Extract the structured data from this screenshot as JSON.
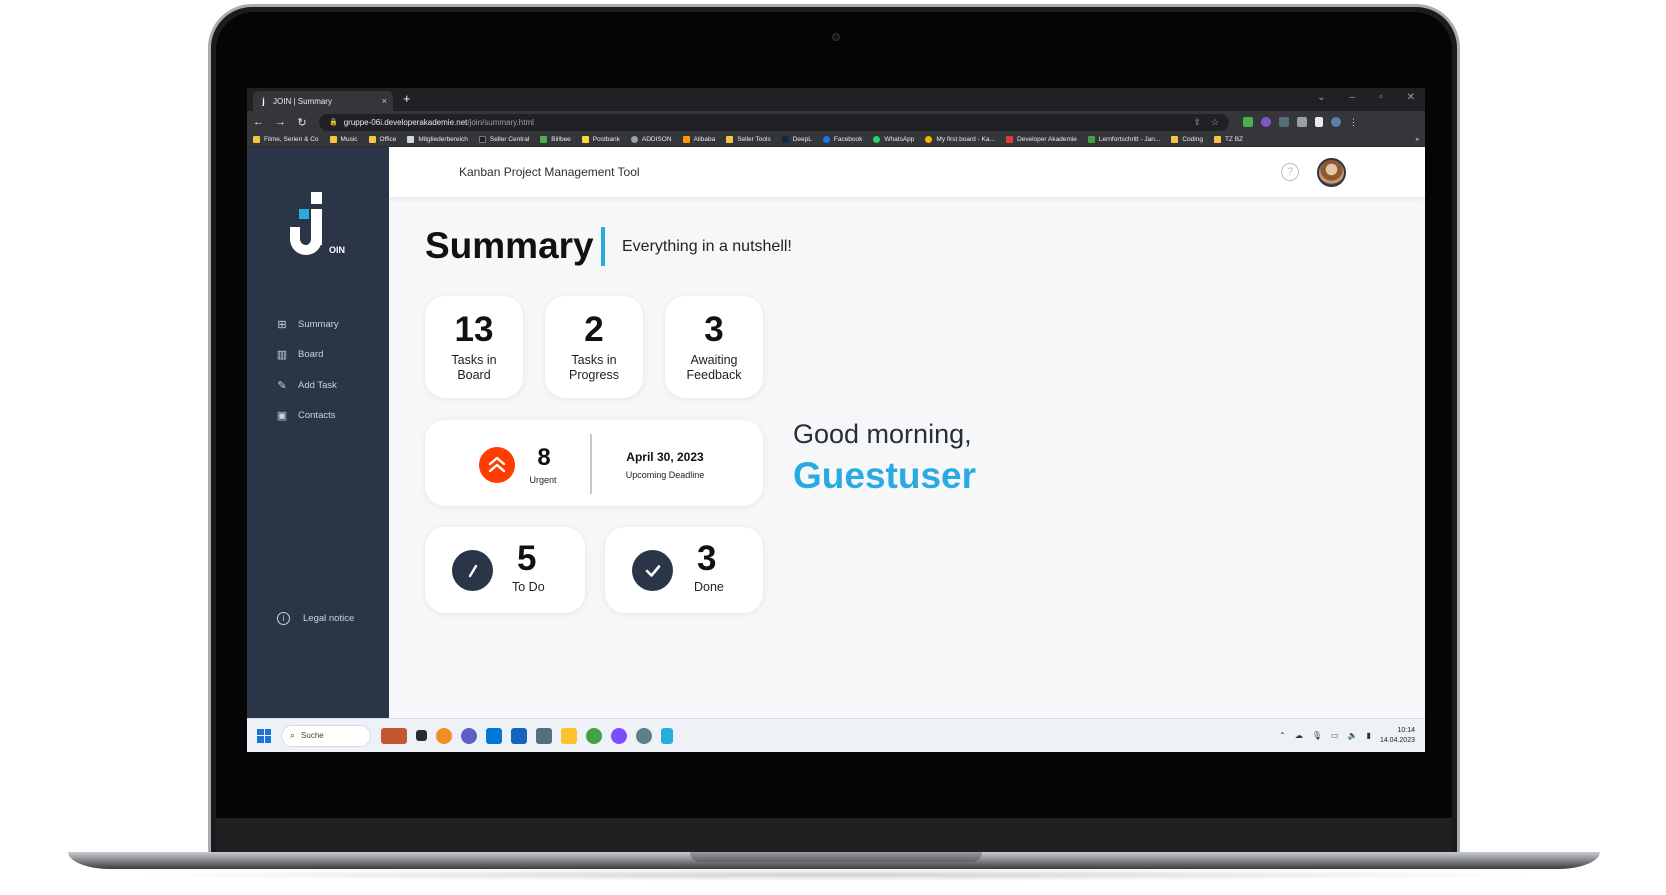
{
  "browser": {
    "tab_title": "JOIN | Summary",
    "tab_close": "×",
    "new_tab": "+",
    "url_host": "gruppe-06i.developerakademie.net",
    "url_path": "/join/summary.html",
    "bookmarks": [
      "Filme, Serien & Co",
      "Music",
      "Office",
      "Mitgliederbereich",
      "Seller Central",
      "Billbee",
      "Postbank",
      "ADDISON",
      "Alibaba",
      "Seller Tools",
      "DeepL",
      "Facebook",
      "WhatsApp",
      "My first board - Ka...",
      "Developer Akademie",
      "Lernfortschritt - Jan...",
      "Coding",
      "TZ BZ"
    ],
    "bookmarks_overflow": "»"
  },
  "app": {
    "logo_text": "OIN",
    "header_title": "Kanban Project Management Tool",
    "help_symbol": "?",
    "nav": {
      "summary": "Summary",
      "board": "Board",
      "add_task": "Add Task",
      "contacts": "Contacts",
      "legal": "Legal notice"
    },
    "page_title": "Summary",
    "subtitle": "Everything in a nutshell!",
    "stats": {
      "tasks_board_num": "13",
      "tasks_board_lbl1": "Tasks in",
      "tasks_board_lbl2": "Board",
      "progress_num": "2",
      "progress_lbl1": "Tasks in",
      "progress_lbl2": "Progress",
      "feedback_num": "3",
      "feedback_lbl1": "Awaiting",
      "feedback_lbl2": "Feedback",
      "urgent_num": "8",
      "urgent_lbl": "Urgent",
      "deadline_date": "April 30, 2023",
      "deadline_lbl": "Upcoming Deadline",
      "todo_num": "5",
      "todo_lbl": "To Do",
      "done_num": "3",
      "done_lbl": "Done"
    },
    "greeting": "Good morning,",
    "user_name": "Guestuser"
  },
  "taskbar": {
    "search_label": "Suche",
    "time": "10:14",
    "date": "14.04.2023"
  },
  "colors": {
    "sidebar": "#2a3647",
    "accent": "#29abe2",
    "urgent": "#ff3d00"
  }
}
